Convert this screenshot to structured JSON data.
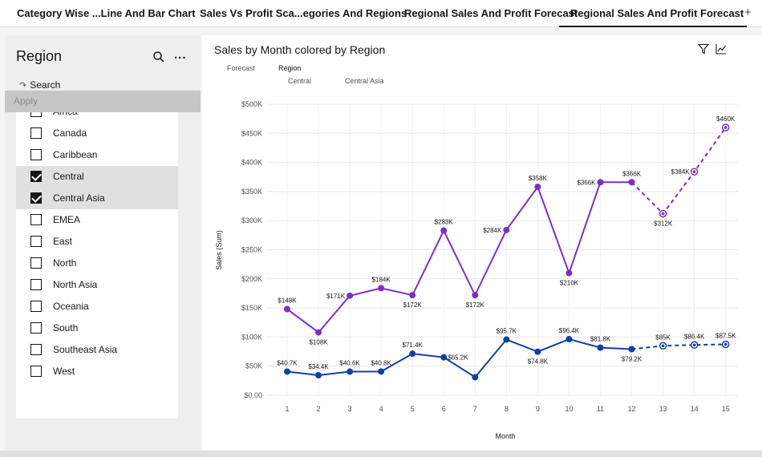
{
  "tabs": [
    {
      "label": "Category Wise ...Line And Bar Chart",
      "active": false
    },
    {
      "label": "Sales Vs Profit Sca...egories And Regions",
      "active": false
    },
    {
      "label": "Regional Sales And Profit Forecast",
      "active": false
    },
    {
      "label": "Regional Sales And Profit Forecast",
      "active": true
    }
  ],
  "tab_add": "+",
  "filter": {
    "title": "Region",
    "more": "...",
    "search_label": "Search",
    "apply_label": "Apply",
    "items": [
      {
        "label": "Africa",
        "checked": false
      },
      {
        "label": "Canada",
        "checked": false
      },
      {
        "label": "Caribbean",
        "checked": false
      },
      {
        "label": "Central",
        "checked": true
      },
      {
        "label": "Central Asia",
        "checked": true
      },
      {
        "label": "EMEA",
        "checked": false
      },
      {
        "label": "East",
        "checked": false
      },
      {
        "label": "North",
        "checked": false
      },
      {
        "label": "North Asia",
        "checked": false
      },
      {
        "label": "Oceania",
        "checked": false
      },
      {
        "label": "South",
        "checked": false
      },
      {
        "label": "Southeast Asia",
        "checked": false
      },
      {
        "label": "West",
        "checked": false
      }
    ]
  },
  "chart": {
    "title": "Sales by Month colored by Region",
    "legend_forecast": "Forecast",
    "legend_region": "Region",
    "legend_items": [
      "Central",
      "Central Asia"
    ]
  },
  "chart_data": {
    "type": "line",
    "title": "Sales by Month colored by Region",
    "xlabel": "Month",
    "ylabel": "Sales (Sum)",
    "categories": [
      "1",
      "2",
      "3",
      "4",
      "5",
      "6",
      "7",
      "8",
      "9",
      "10",
      "11",
      "12",
      "13",
      "14",
      "15"
    ],
    "ylim": [
      0,
      500000
    ],
    "y_ticks": [
      "$0.00",
      "$50K",
      "$100K",
      "$150K",
      "$200K",
      "$250K",
      "$300K",
      "$350K",
      "$400K",
      "$450K",
      "$500K"
    ],
    "y_tick_values": [
      0,
      50000,
      100000,
      150000,
      200000,
      250000,
      300000,
      350000,
      400000,
      450000,
      500000
    ],
    "grid": true,
    "forecast_start_index": 12,
    "series": [
      {
        "name": "Central",
        "color": "#7b2fc8",
        "values": [
          148000,
          108000,
          171000,
          184000,
          172000,
          283000,
          172000,
          284000,
          358000,
          210000,
          366000,
          366000,
          312000,
          384000,
          460000
        ],
        "labels": [
          "$148K",
          "$108K",
          "$171K",
          "$184K",
          "$172K",
          "$283K",
          "$172K",
          "$284K",
          "$358K",
          "$210K",
          "$366K",
          "$366K",
          "$312K",
          "$384K",
          "$460K"
        ]
      },
      {
        "name": "Central Asia",
        "color": "#0f3fa6",
        "values": [
          40700,
          34400,
          40600,
          40800,
          71400,
          65200,
          31000,
          95700,
          74800,
          96400,
          81800,
          79200,
          85000,
          86400,
          87500
        ],
        "labels": [
          "$40.7K",
          "$34.4K",
          "$40.6K",
          "$40.8K",
          "$71.4K",
          "$65.2K",
          "",
          "$95.7K",
          "$74.8K",
          "$96.4K",
          "$81.8K",
          "$79.2K",
          "$85K",
          "$86.4K",
          "$87.5K"
        ]
      }
    ]
  }
}
